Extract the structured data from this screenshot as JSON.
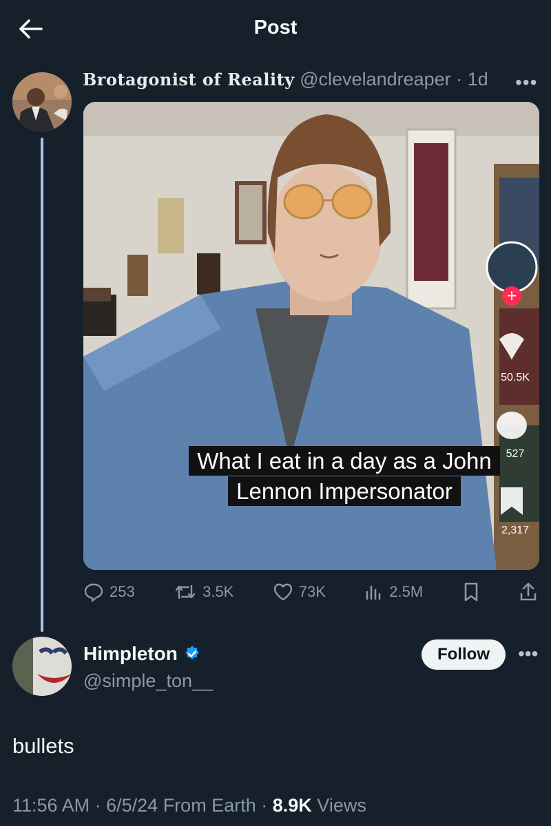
{
  "header": {
    "title": "Post"
  },
  "post": {
    "author_name": "Brotagonist of Reality",
    "handle": "@clevelandreaper",
    "separator": "·",
    "age": "1d",
    "media": {
      "caption_line1": "What I eat in a day as a John",
      "caption_line2": "Lennon Impersonator",
      "likes": "50.5K",
      "comments": "527",
      "saves": "2,317"
    },
    "stats": {
      "replies": "253",
      "reposts": "3.5K",
      "likes": "73K",
      "views": "2.5M"
    }
  },
  "reply": {
    "name": "Himpleton",
    "handle": "@simple_ton__",
    "follow_label": "Follow",
    "text": "bullets",
    "time": "11:56 AM",
    "date": "6/5/24",
    "source": "From Earth",
    "views": "8.9K",
    "views_label": "Views"
  },
  "colors": {
    "background": "#15202b",
    "muted": "#8b98a5",
    "verified": "#1d9bf0",
    "thread_line": "#a8c6e6"
  }
}
